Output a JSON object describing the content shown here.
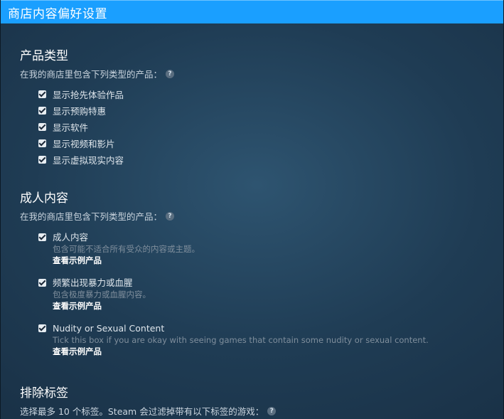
{
  "window": {
    "title": "商店内容偏好设置"
  },
  "product_types": {
    "title": "产品类型",
    "subtitle": "在我的商店里包含下列类型的产品：",
    "help_icon": "question-icon",
    "options": [
      {
        "label": "显示抢先体验作品",
        "checked": true
      },
      {
        "label": "显示预购特惠",
        "checked": true
      },
      {
        "label": "显示软件",
        "checked": true
      },
      {
        "label": "显示视频和影片",
        "checked": true
      },
      {
        "label": "显示虚拟现实内容",
        "checked": true
      }
    ]
  },
  "adult_content": {
    "title": "成人内容",
    "subtitle": "在我的商店里包含下列类型的产品：",
    "help_icon": "question-icon",
    "options": [
      {
        "label": "成人内容",
        "description": "包含可能不适合所有受众的内容或主题。",
        "link": "查看示例产品",
        "checked": true
      },
      {
        "label": "频繁出现暴力或血腥",
        "description": "包含极度暴力或血腥内容。",
        "link": "查看示例产品",
        "checked": true
      },
      {
        "label": "Nudity or Sexual Content",
        "description": "Tick this box if you are okay with seeing games that contain some nudity or sexual content.",
        "link": "查看示例产品",
        "checked": true
      }
    ]
  },
  "exclude_tags": {
    "title": "排除标签",
    "subtitle": "选择最多 10 个标签。Steam 会过滤掉带有以下标签的游戏：",
    "help_icon": "question-icon"
  },
  "colors": {
    "accent": "#1a9fff",
    "background": "#1b2838",
    "text": "#dfe6ec",
    "muted": "#7f8e9c"
  }
}
